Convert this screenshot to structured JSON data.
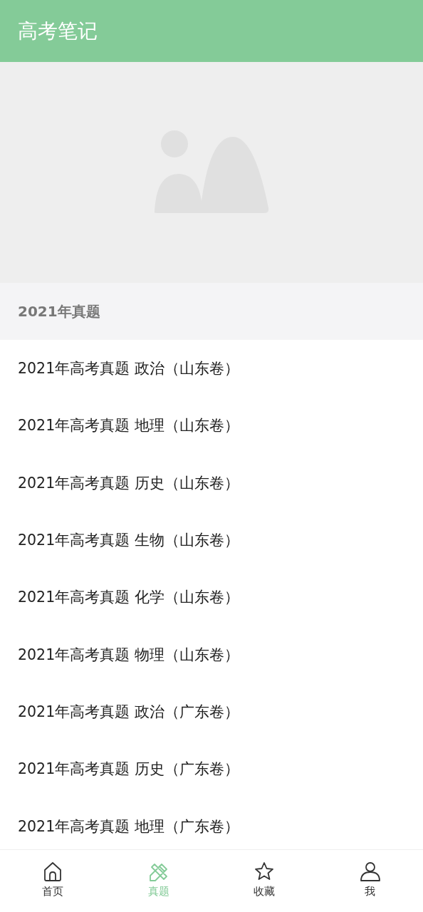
{
  "app_bar": {
    "title": "高考笔记"
  },
  "section": {
    "title": "2021年真题"
  },
  "items": [
    {
      "label": "2021年高考真题 政治（山东卷）"
    },
    {
      "label": "2021年高考真题 地理（山东卷）"
    },
    {
      "label": "2021年高考真题 历史（山东卷）"
    },
    {
      "label": "2021年高考真题 生物（山东卷）"
    },
    {
      "label": "2021年高考真题 化学（山东卷）"
    },
    {
      "label": "2021年高考真题 物理（山东卷）"
    },
    {
      "label": "2021年高考真题 政治（广东卷）"
    },
    {
      "label": "2021年高考真题 历史（广东卷）"
    },
    {
      "label": "2021年高考真题 地理（广东卷）"
    }
  ],
  "bottom_nav": [
    {
      "kind": "home",
      "label": "首页",
      "selected": false
    },
    {
      "kind": "exam",
      "label": "真题",
      "selected": true
    },
    {
      "kind": "favorites",
      "label": "收藏",
      "selected": false
    },
    {
      "kind": "profile",
      "label": "我",
      "selected": false
    }
  ]
}
